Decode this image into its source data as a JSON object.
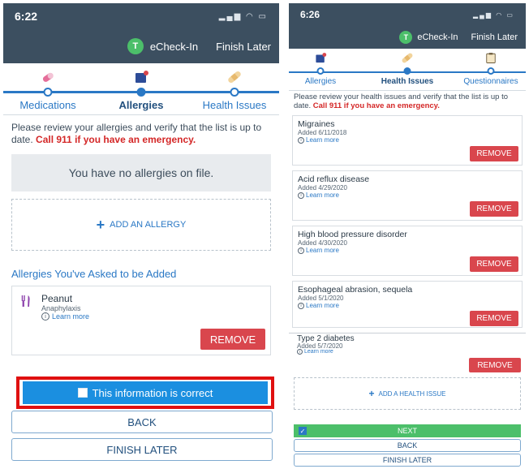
{
  "left": {
    "status_time": "6:22",
    "status_icons": "▂▄▆ ◠ ▭",
    "avatar_letter": "T",
    "echeck_label": "eCheck-In",
    "finish_later_link": "Finish Later",
    "steps": [
      {
        "label": "Medications"
      },
      {
        "label": "Allergies"
      },
      {
        "label": "Health Issues"
      }
    ],
    "intro_text": "Please review your allergies and verify that the list is up to date. ",
    "intro_warning": "Call 911 if you have an emergency.",
    "no_allergies": "You have no allergies on file.",
    "add_allergy": "ADD AN ALLERGY",
    "asked_heading": "Allergies You've Asked to be Added",
    "allergy": {
      "name": "Peanut",
      "reaction": "Anaphylaxis",
      "learn_more": "Learn more"
    },
    "remove_label": "REMOVE",
    "correct_label": "This information is correct",
    "back_label": "BACK",
    "finish_label": "FINISH LATER"
  },
  "right": {
    "status_time": "6:26",
    "status_icons": "▂▄▆ ◠ ▭",
    "avatar_letter": "T",
    "echeck_label": "eCheck-In",
    "finish_later_link": "Finish Later",
    "steps": [
      {
        "label": "Allergies"
      },
      {
        "label": "Health Issues"
      },
      {
        "label": "Questionnaires"
      }
    ],
    "intro_text": "Please review your health issues and verify that the list is up to date. ",
    "intro_warning": "Call 911 if you have an emergency.",
    "issues": [
      {
        "name": "Migraines",
        "added": "Added 6/11/2018",
        "learn_more": "Learn more"
      },
      {
        "name": "Acid reflux disease",
        "added": "Added 4/29/2020",
        "learn_more": "Learn more"
      },
      {
        "name": "High blood pressure disorder",
        "added": "Added 4/30/2020",
        "learn_more": "Learn more"
      },
      {
        "name": "Esophageal abrasion, sequela",
        "added": "Added 5/1/2020",
        "learn_more": "Learn more"
      }
    ],
    "remove_label": "REMOVE"
  },
  "bottom_right": {
    "issue": {
      "name": "Type 2 diabetes",
      "added": "Added 5/7/2020",
      "learn_more": "Learn more"
    },
    "remove_label": "REMOVE",
    "add_health_issue": "ADD A HEALTH ISSUE",
    "next_label": "NEXT",
    "back_label": "BACK",
    "finish_label": "FINISH LATER"
  },
  "colors": {
    "header": "#3c4f60",
    "accent_blue": "#2a78c5",
    "remove_red": "#d9464d",
    "highlight_red": "#e01010",
    "next_green": "#4cbf6a",
    "correct_blue": "#1b8fe0"
  }
}
